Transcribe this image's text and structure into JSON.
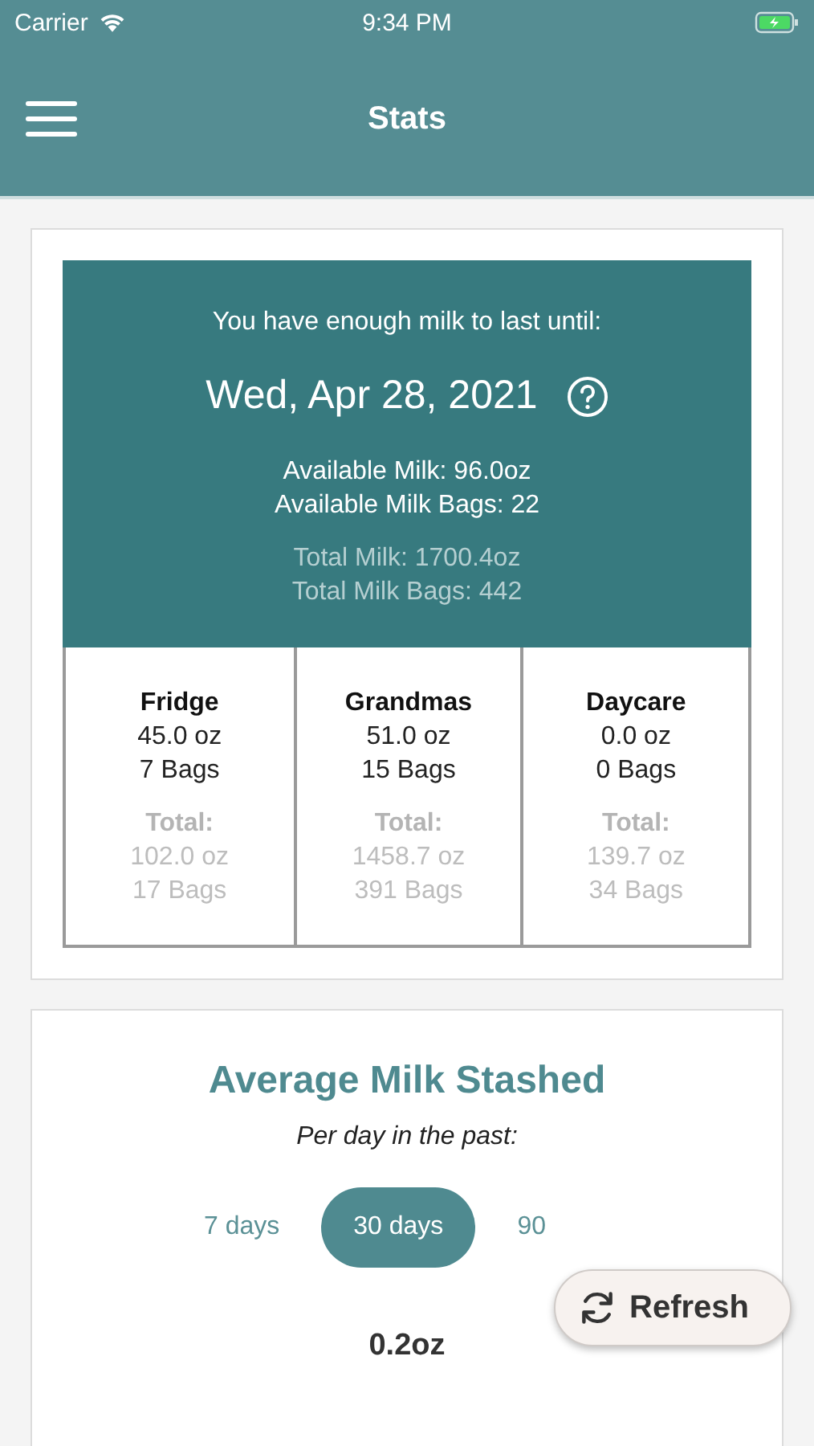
{
  "status_bar": {
    "carrier": "Carrier",
    "time": "9:34 PM"
  },
  "nav": {
    "title": "Stats"
  },
  "summary": {
    "headline": "You have enough milk to last until:",
    "date": "Wed, Apr 28, 2021",
    "available_milk": "Available Milk: 96.0oz",
    "available_bags": "Available Milk Bags: 22",
    "total_milk": "Total Milk: 1700.4oz",
    "total_bags": "Total Milk Bags: 442"
  },
  "locations": [
    {
      "name": "Fridge",
      "amount": "45.0 oz",
      "bags": "7 Bags",
      "total_label": "Total:",
      "total_amount": "102.0 oz",
      "total_bags": "17 Bags"
    },
    {
      "name": "Grandmas",
      "amount": "51.0 oz",
      "bags": "15 Bags",
      "total_label": "Total:",
      "total_amount": "1458.7 oz",
      "total_bags": "391 Bags"
    },
    {
      "name": "Daycare",
      "amount": "0.0 oz",
      "bags": "0 Bags",
      "total_label": "Total:",
      "total_amount": "139.7 oz",
      "total_bags": "34 Bags"
    }
  ],
  "average": {
    "title": "Average Milk Stashed",
    "subtitle": "Per day in the past:",
    "periods": [
      {
        "label": "7 days",
        "selected": false
      },
      {
        "label": "30 days",
        "selected": true
      },
      {
        "label": "90",
        "selected": false
      }
    ],
    "value": "0.2oz"
  },
  "refresh_button": {
    "label": "Refresh"
  }
}
